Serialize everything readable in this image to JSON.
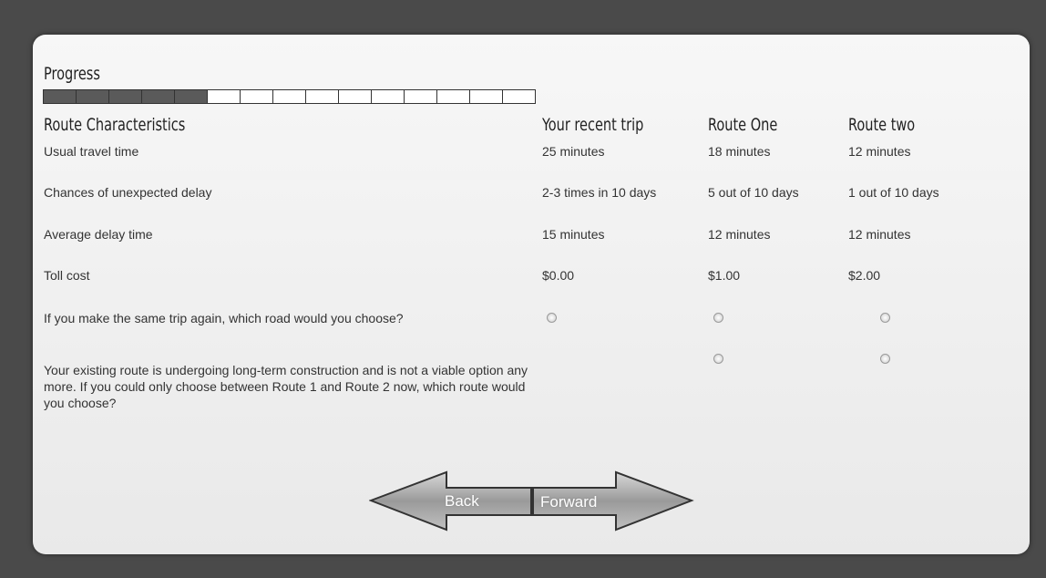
{
  "progress": {
    "label": "Progress",
    "filled_segments": 5,
    "total_segments": 15
  },
  "table": {
    "headers": [
      "Route Characteristics",
      "Your recent trip",
      "Route One",
      "Route two"
    ],
    "rows": [
      {
        "label": "Usual travel time",
        "values": [
          "25 minutes",
          "18 minutes",
          "12 minutes"
        ]
      },
      {
        "label": "Chances of unexpected delay",
        "values": [
          "2-3 times in 10 days",
          "5 out of 10 days",
          "1 out of 10 days"
        ]
      },
      {
        "label": "Average delay time",
        "values": [
          "15 minutes",
          "12 minutes",
          "12 minutes"
        ]
      },
      {
        "label": "Toll cost",
        "values": [
          "$0.00",
          "$1.00",
          "$2.00"
        ]
      }
    ]
  },
  "questions": {
    "q1": "If you make the same trip again, which road would you choose?",
    "q2": "Your existing route is undergoing long-term construction and is not a viable option any more. If you could only choose between Route 1 and Route 2 now, which route would you choose?"
  },
  "nav": {
    "back_label": "Back",
    "forward_label": "Forward"
  }
}
